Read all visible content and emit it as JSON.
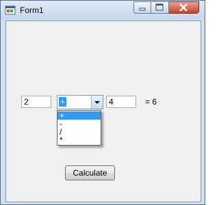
{
  "window": {
    "title": "Form1",
    "icon": "windows-form-icon"
  },
  "titlebar_buttons": {
    "minimize_icon": "minimize-icon",
    "maximize_icon": "maximize-icon",
    "close_icon": "close-icon"
  },
  "form": {
    "operand1": "2",
    "operator": "+",
    "operand2": "4",
    "result": "= 6",
    "calculate_label": "Calculate"
  },
  "operator_dropdown": {
    "options": [
      "+",
      "-",
      "/",
      "*"
    ],
    "selected_index": 0
  },
  "colors": {
    "selection": "#3399ff",
    "titlebar": "#c4d7ee",
    "client_bg": "#f0f0f0"
  }
}
